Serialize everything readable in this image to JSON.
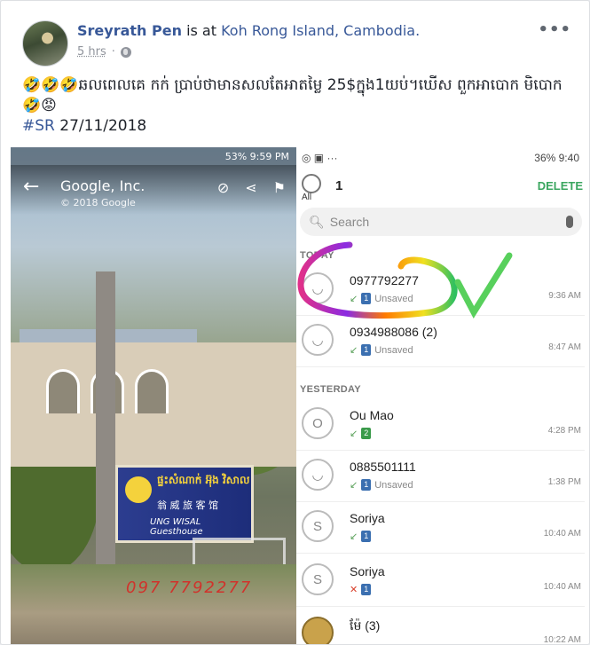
{
  "post": {
    "author": "Sreyrath Pen",
    "is_at": "is at",
    "location": "Koh Rong Island, Cambodia.",
    "time": "5 hrs",
    "text": "🤣🤣🤣ឆលពេលគេ កក់ ប្រាប់ថាមានសលតែអាតម្លៃ 25$ក្នុង1យប់។ឃើស ពួកអាបោក មិបោក🤣😡",
    "hashtag": "#SR",
    "date": "27/11/2018",
    "more_icon": "•••"
  },
  "streetview": {
    "status": "53%  9:59 PM",
    "title": "Google, Inc.",
    "copyright": "© 2018 Google",
    "sign_khmer": "ផ្ទះសំណាក់ អ៊ុង វិសាល",
    "sign_chinese": "翁 威 旅 客 馆",
    "sign_english": "UNG WISAL Guesthouse",
    "handwritten_number": "097 7792277"
  },
  "phone": {
    "status_right": "36%  9:40",
    "count": "1",
    "all_label": "All",
    "delete_label": "DELETE",
    "search_placeholder": "Search",
    "sections": {
      "today": "TODAY",
      "yesterday": "YESTERDAY"
    },
    "calls": [
      {
        "name": "0977792277",
        "sim": "1",
        "sub": "Unsaved",
        "time": "9:36 AM",
        "avatar": "person",
        "type": "incoming"
      },
      {
        "name": "0934988086 (2)",
        "sim": "1",
        "sub": "Unsaved",
        "time": "8:47 AM",
        "avatar": "person",
        "type": "incoming"
      },
      {
        "name": "Ou Mao",
        "sim": "2",
        "sub": "",
        "time": "4:28 PM",
        "avatar": "O",
        "type": "incoming"
      },
      {
        "name": "0885501111",
        "sim": "1",
        "sub": "Unsaved",
        "time": "1:38 PM",
        "avatar": "person",
        "type": "incoming"
      },
      {
        "name": "Soriya",
        "sim": "1",
        "sub": "",
        "time": "10:40 AM",
        "avatar": "S",
        "type": "incoming"
      },
      {
        "name": "Soriya",
        "sim": "1",
        "sub": "",
        "time": "10:40 AM",
        "avatar": "S",
        "type": "missed"
      },
      {
        "name": "ម៉ែ (3)",
        "sim": "1",
        "sub": "",
        "time": "10:22 AM",
        "avatar": "photo",
        "type": "incoming"
      }
    ]
  },
  "colors": {
    "link": "#385898",
    "delete": "#3aa65f",
    "sim": "#3b6fb0"
  }
}
